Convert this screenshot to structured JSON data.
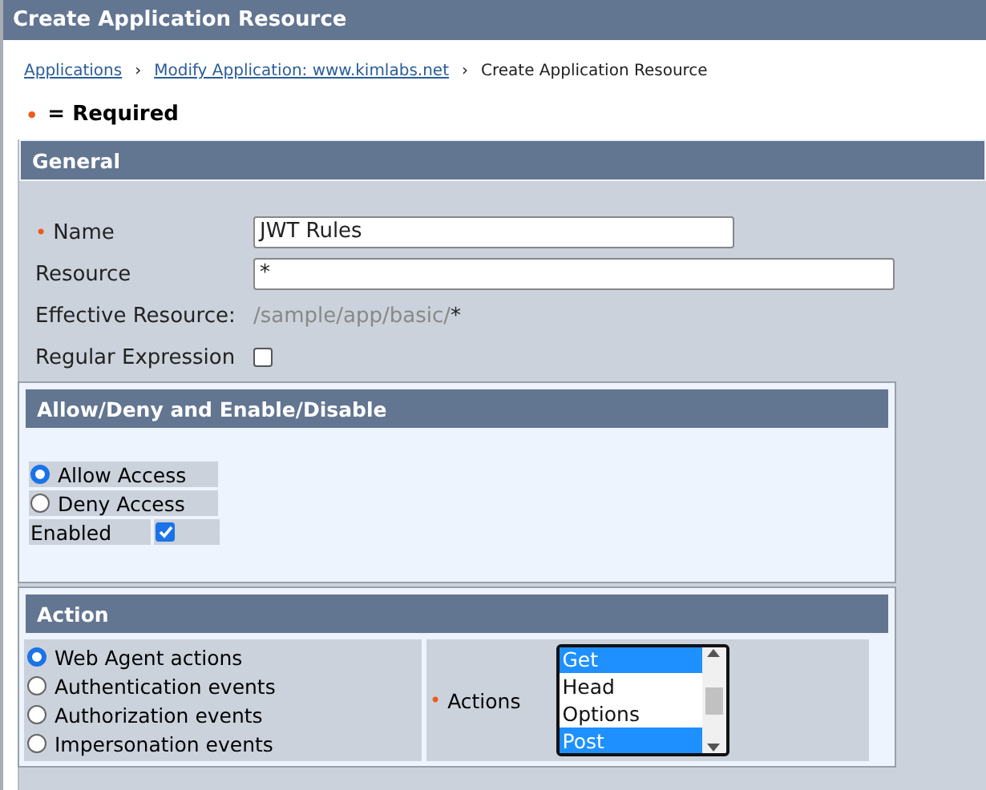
{
  "window": {
    "title": "Create Application Resource"
  },
  "breadcrumb": [
    {
      "label": "Applications",
      "kind": "link"
    },
    {
      "label": "Modify Application: www.kimlabs.net",
      "kind": "link"
    },
    {
      "label": "Create Application Resource",
      "kind": "current"
    }
  ],
  "separator": "›",
  "required_legend": {
    "mark": "•",
    "text": "= Required"
  },
  "general": {
    "title": "General",
    "fields": [
      {
        "label": "Name",
        "required": true,
        "kind": "input",
        "value": "JWT Rules",
        "wide": false
      },
      {
        "label": "Resource",
        "required": false,
        "kind": "input",
        "value": "*",
        "wide": true
      },
      {
        "label": "Effective Resource:",
        "required": false,
        "kind": "text",
        "prefix": "/sample/app/basic/",
        "value": "*"
      },
      {
        "label": "Regular Expression",
        "required": false,
        "kind": "checkbox",
        "checked": false
      }
    ]
  },
  "allow_deny": {
    "title": "Allow/Deny and Enable/Disable",
    "options": [
      {
        "label": "Allow Access",
        "selected": true
      },
      {
        "label": "Deny Access",
        "selected": false
      }
    ],
    "enabled": {
      "label": "Enabled",
      "checked": true
    }
  },
  "action": {
    "title": "Action",
    "types": [
      {
        "label": "Web Agent actions",
        "selected": true
      },
      {
        "label": "Authentication events",
        "selected": false
      },
      {
        "label": "Authorization events",
        "selected": false
      },
      {
        "label": "Impersonation events",
        "selected": false
      }
    ],
    "actions_label": "Actions",
    "actions_required": true,
    "actions": [
      {
        "label": "Get",
        "selected": true
      },
      {
        "label": "Head",
        "selected": false
      },
      {
        "label": "Options",
        "selected": false
      },
      {
        "label": "Post",
        "selected": true
      }
    ]
  }
}
